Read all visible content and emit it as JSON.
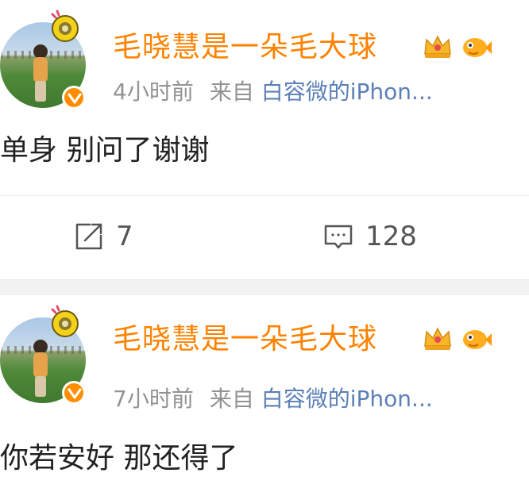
{
  "posts": [
    {
      "username": "毛晓慧是一朵毛大球",
      "time": "4小时前",
      "source_prefix": "来自",
      "source": "白容微的iPhon...",
      "content": "单身 别问了谢谢",
      "actions": {
        "repost_count": "7",
        "comment_count": "128"
      },
      "icons": [
        "verified-badge-icon",
        "crown-icon",
        "fish-icon",
        "repost-icon",
        "comment-icon"
      ]
    },
    {
      "username": "毛晓慧是一朵毛大球",
      "time": "7小时前",
      "source_prefix": "来自",
      "source": "白容微的iPhon...",
      "content": "你若安好 那还得了"
    }
  ],
  "colors": {
    "username": "#ff8200",
    "meta": "#939393",
    "source_link": "#5b7fb7",
    "content": "#222222",
    "verified_badge": "#ff8d00",
    "separator": "#f2f2f2"
  }
}
